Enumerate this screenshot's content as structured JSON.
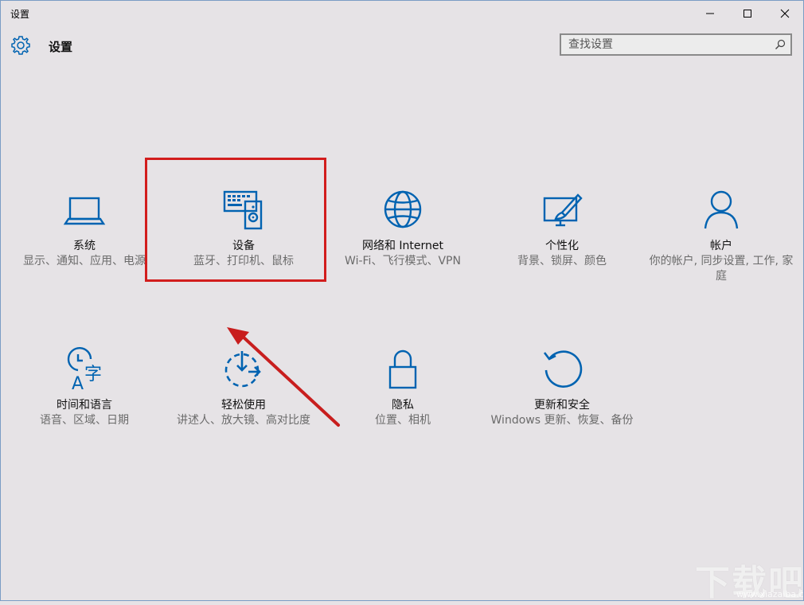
{
  "window": {
    "title": "设置",
    "minimize_label": "minimize",
    "maximize_label": "maximize",
    "close_label": "close"
  },
  "header": {
    "title": "设置",
    "icon": "gear-icon"
  },
  "search": {
    "placeholder": "查找设置",
    "icon": "search-icon"
  },
  "accent_color": "#0063b1",
  "highlight_color": "#d21d1d",
  "tiles": [
    {
      "icon": "laptop-icon",
      "name": "系统",
      "desc": "显示、通知、应用、电源"
    },
    {
      "icon": "devices-icon",
      "name": "设备",
      "desc": "蓝牙、打印机、鼠标"
    },
    {
      "icon": "globe-icon",
      "name": "网络和 Internet",
      "desc": "Wi-Fi、飞行模式、VPN"
    },
    {
      "icon": "personalize-icon",
      "name": "个性化",
      "desc": "背景、锁屏、颜色"
    },
    {
      "icon": "person-icon",
      "name": "帐户",
      "desc": "你的帐户, 同步设置, 工作, 家庭"
    },
    {
      "icon": "time-language-icon",
      "name": "时间和语言",
      "desc": "语音、区域、日期"
    },
    {
      "icon": "ease-of-access-icon",
      "name": "轻松使用",
      "desc": "讲述人、放大镜、高对比度"
    },
    {
      "icon": "lock-icon",
      "name": "隐私",
      "desc": "位置、相机"
    },
    {
      "icon": "update-icon",
      "name": "更新和安全",
      "desc": "Windows 更新、恢复、备份"
    }
  ],
  "watermark": {
    "text": "下载吧",
    "sub": "www.xiazaiba.com"
  }
}
